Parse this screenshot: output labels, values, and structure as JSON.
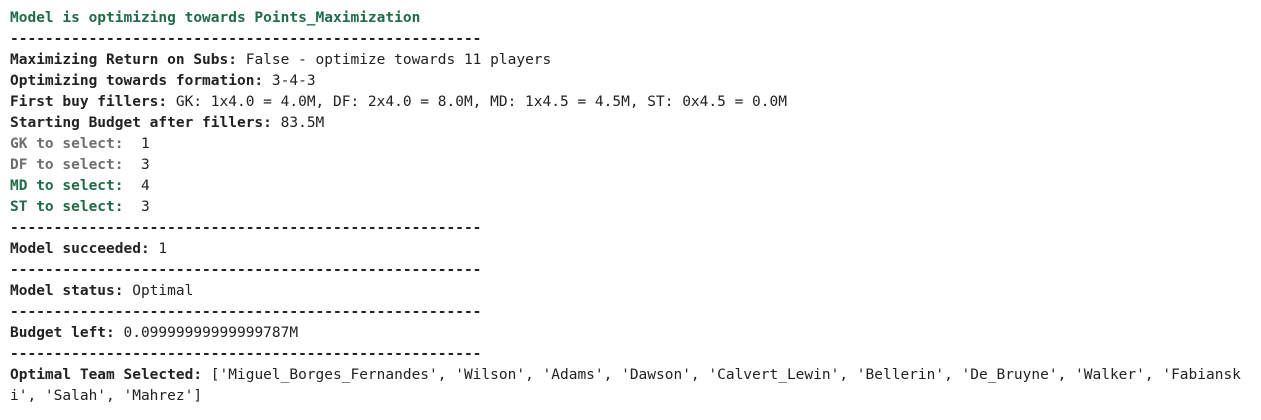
{
  "header": "Model is optimizing towards Points_Maximization",
  "separator": "------------------------------------------------------",
  "subs": {
    "label": "Maximizing Return on Subs:",
    "value": " False - optimize towards 11 players"
  },
  "formation": {
    "label": "Optimizing towards formation:",
    "value": " 3-4-3"
  },
  "fillers": {
    "label": "First buy fillers:",
    "value": " GK: 1x4.0 = 4.0M, DF: 2x4.0 = 8.0M, MD: 1x4.5 = 4.5M, ST: 0x4.5 = 0.0M"
  },
  "budget_start": {
    "label": "Starting Budget after fillers:",
    "value": " 83.5M"
  },
  "positions": [
    {
      "label": "GK to select: ",
      "value": " 1"
    },
    {
      "label": "DF to select: ",
      "value": " 3"
    },
    {
      "label": "MD to select: ",
      "value": " 4"
    },
    {
      "label": "ST to select: ",
      "value": " 3"
    }
  ],
  "succeeded": {
    "label": "Model succeeded:",
    "value": " 1"
  },
  "status": {
    "label": "Model status:",
    "value": " Optimal"
  },
  "budget_left": {
    "label": "Budget left:",
    "value": " 0.09999999999999787M"
  },
  "team": {
    "label": "Optimal Team Selected:",
    "value": " ['Miguel_Borges_Fernandes', 'Wilson', 'Adams', 'Dawson', 'Calvert_Lewin', 'Bellerin', 'De_Bruyne', 'Walker', 'Fabianski', 'Salah', 'Mahrez']"
  },
  "colors": {
    "title": "#1f6b47",
    "gray_label": "#6e6e6e",
    "text": "#222222"
  }
}
